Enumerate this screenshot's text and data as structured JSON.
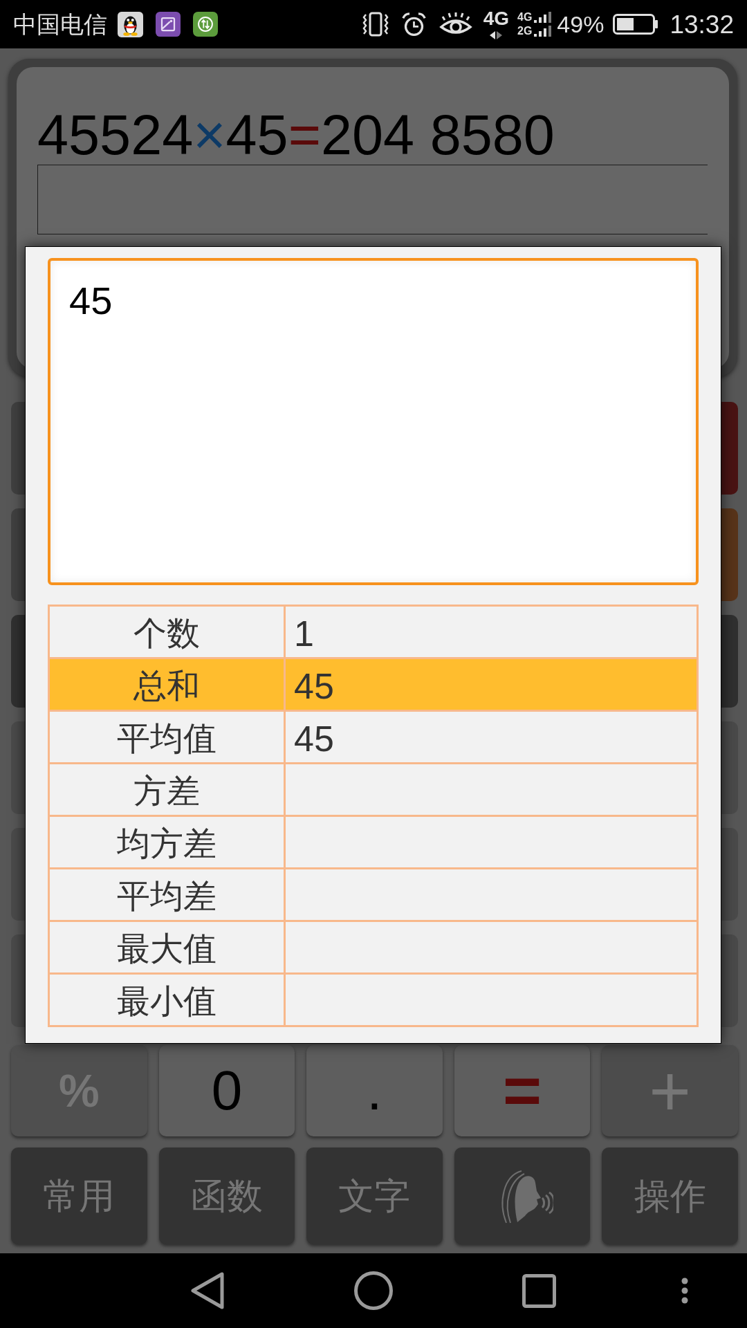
{
  "status_bar": {
    "carrier": "中国电信",
    "network": "4G",
    "signal_labels": [
      "4G",
      "2G"
    ],
    "battery": "49%",
    "time": "13:32"
  },
  "calculator": {
    "expression": [
      {
        "kind": "operand",
        "text": "45524"
      },
      {
        "kind": "times",
        "text": "×"
      },
      {
        "kind": "operand",
        "text": "45"
      },
      {
        "kind": "equals",
        "text": "="
      },
      {
        "kind": "operand",
        "text": "204 8580"
      }
    ],
    "keys": [
      [
        {
          "kind": "function",
          "label": "%"
        },
        {
          "kind": "digit",
          "label": "0"
        },
        {
          "kind": "digit",
          "label": "."
        },
        {
          "kind": "equals",
          "label": "="
        },
        {
          "kind": "operator",
          "label": "+"
        }
      ],
      [
        {
          "kind": "mode",
          "label": "常用"
        },
        {
          "kind": "mode",
          "label": "函数"
        },
        {
          "kind": "mode",
          "label": "文字"
        },
        {
          "kind": "voice"
        },
        {
          "kind": "mode",
          "label": "操作"
        }
      ]
    ]
  },
  "dialog": {
    "input_value": "45",
    "stats": [
      {
        "label": "个数",
        "value": "1",
        "selected": false
      },
      {
        "label": "总和",
        "value": "45",
        "selected": true
      },
      {
        "label": "平均值",
        "value": "45",
        "selected": false
      },
      {
        "label": "方差",
        "selected": false
      },
      {
        "label": "均方差",
        "selected": false
      },
      {
        "label": "平均差",
        "selected": false
      },
      {
        "label": "最大值",
        "selected": false
      },
      {
        "label": "最小值",
        "selected": false
      }
    ]
  }
}
